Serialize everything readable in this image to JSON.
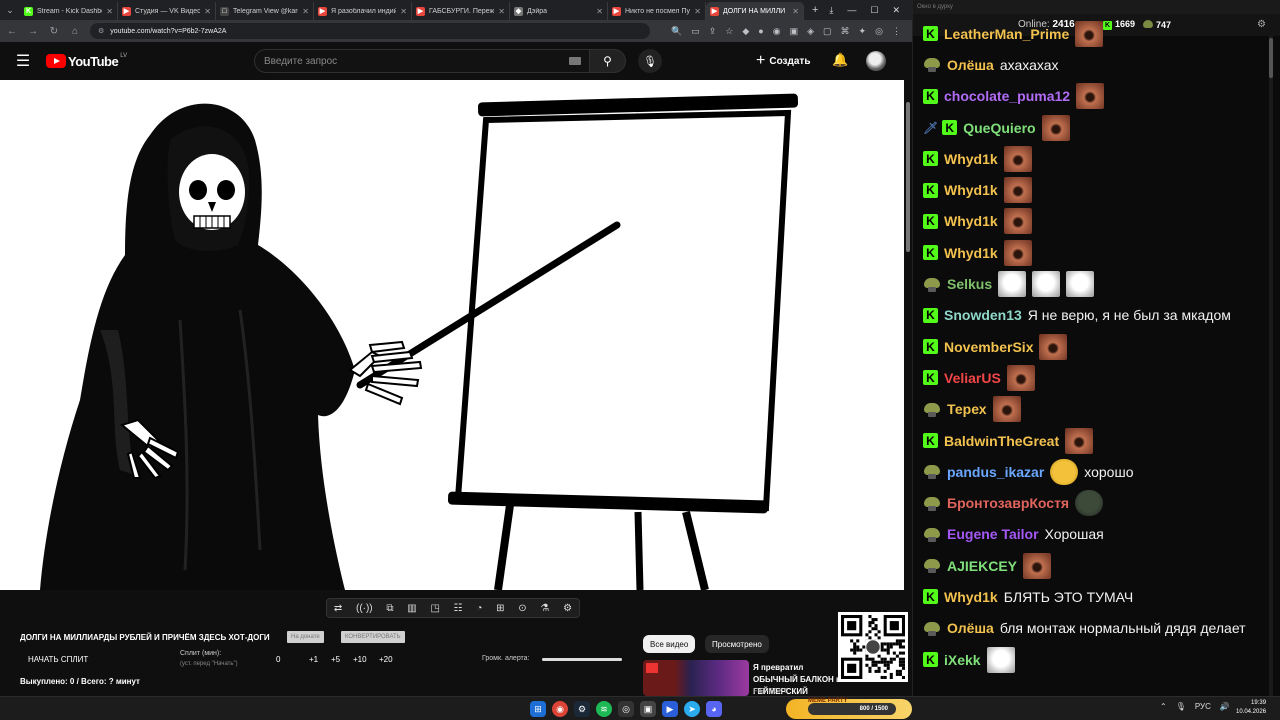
{
  "browser": {
    "tabs": [
      {
        "title": "Stream - Kick Dashboard",
        "color": "#53fc18",
        "letter": "K"
      },
      {
        "title": "Студия — VK Видео Live",
        "color": "#e8453c",
        "letter": "▶"
      },
      {
        "title": "Telegram View @kargo",
        "color": "#444",
        "letter": "□"
      },
      {
        "title": "Я разоблачил индийск",
        "color": "#e8453c",
        "letter": "▶"
      },
      {
        "title": "ГАБСБУРГИ. Пережит",
        "color": "#e8453c",
        "letter": "▶"
      },
      {
        "title": "Дэйра",
        "color": "#777",
        "letter": "◆"
      },
      {
        "title": "Никто не посмел Пути",
        "color": "#e8453c",
        "letter": "▶"
      },
      {
        "title": "ДОЛГИ НА МИЛЛИ",
        "color": "#e8453c",
        "letter": "▶"
      }
    ],
    "url": "youtube.com/watch?v=P6b2-7zwA2A"
  },
  "youtube": {
    "logo_text": "YouTube",
    "country": "LV",
    "search_placeholder": "Введите запрос",
    "create_label": "Создать"
  },
  "panel": {
    "title": "ДОЛГИ НА МИЛЛИАРДЫ РУБЛЕЙ И ПРИЧЁМ ЗДЕСЬ ХОТ-ДОГИ",
    "badge1": "На донате",
    "badge2": "КОНВЕРТИРОВАТЬ",
    "start_split": "НАЧАТЬ СПЛИТ",
    "split_label": "Сплит (мин):",
    "split_sub": "(уст. перед \"Начать\")",
    "nums": [
      "0",
      "+1",
      "+5",
      "+10",
      "+20"
    ],
    "volume_label": "Громк. алерта:",
    "volume_level": 1.0,
    "bought": "Выкуплено: 0 / Всего: ? минут",
    "chip_all": "Все видео",
    "chip_watched": "Просмотрено",
    "rec_title": "Я превратил ОБЫЧНЫЙ БАЛКОН в ГЕЙМЕРСКИЙ",
    "rec_channel": "FISPECKT"
  },
  "chat": {
    "window_title": "Окно в дурку",
    "online_label": "Online:",
    "online_count": "2416",
    "kick_count": "1669",
    "frog_count": "747",
    "colors": {
      "kick": "#53fc18",
      "frog": "#8e9a4a"
    },
    "messages": [
      {
        "badge": "kick",
        "user": "LeatherMan_Prime",
        "color": "#f2c14e",
        "emotes": [
          "face"
        ],
        "text": ""
      },
      {
        "badge": "frog",
        "user": "Олёша",
        "color": "#f2c14e",
        "emotes": [],
        "text": "ахахахах"
      },
      {
        "badge": "kick",
        "user": "chocolate_puma12",
        "color": "#b16cf5",
        "emotes": [
          "face"
        ],
        "text": ""
      },
      {
        "badge": "sword-kick",
        "user": "QueQuiero",
        "color": "#7fe07a",
        "emotes": [
          "face"
        ],
        "text": ""
      },
      {
        "badge": "kick",
        "user": "Whyd1k",
        "color": "#f2c14e",
        "emotes": [
          "face"
        ],
        "text": ""
      },
      {
        "badge": "kick",
        "user": "Whyd1k",
        "color": "#f2c14e",
        "emotes": [
          "face"
        ],
        "text": ""
      },
      {
        "badge": "kick",
        "user": "Whyd1k",
        "color": "#f2c14e",
        "emotes": [
          "face"
        ],
        "text": ""
      },
      {
        "badge": "kick",
        "user": "Whyd1k",
        "color": "#f2c14e",
        "emotes": [
          "face"
        ],
        "text": ""
      },
      {
        "badge": "frog",
        "user": "Selkus",
        "color": "#7fc06a",
        "emotes": [
          "cat",
          "cat",
          "cat"
        ],
        "text": ""
      },
      {
        "badge": "kick",
        "user": "Snowden13",
        "color": "#8fd8c8",
        "emotes": [],
        "text": "Я не верю, я не был за мкадом"
      },
      {
        "badge": "kick",
        "user": "NovemberSix",
        "color": "#f2c14e",
        "emotes": [
          "face"
        ],
        "text": ""
      },
      {
        "badge": "kick",
        "user": "VeliarUS",
        "color": "#f24646",
        "emotes": [
          "face"
        ],
        "text": ""
      },
      {
        "badge": "frog",
        "user": "Терех",
        "color": "#f2c14e",
        "emotes": [
          "face"
        ],
        "text": ""
      },
      {
        "badge": "kick",
        "user": "BaldwinTheGreat",
        "color": "#f2c14e",
        "emotes": [
          "face"
        ],
        "text": ""
      },
      {
        "badge": "frog",
        "user": "pandus_ikazar",
        "color": "#6aa7ff",
        "emotes": [
          "lol"
        ],
        "text": "хорошо"
      },
      {
        "badge": "frog",
        "user": "БронтозаврКостя",
        "color": "#e0645c",
        "emotes": [
          "dino"
        ],
        "text": ""
      },
      {
        "badge": "frog",
        "user": "Eugene Tailor",
        "color": "#a458f5",
        "emotes": [],
        "text": "Хорошая"
      },
      {
        "badge": "frog",
        "user": "AJIEKCEY",
        "color": "#7fe07a",
        "emotes": [
          "face"
        ],
        "text": ""
      },
      {
        "badge": "kick",
        "user": "Whyd1k",
        "color": "#f2c14e",
        "emotes": [],
        "text": "БЛЯТЬ ЭТО ТУМАЧ"
      },
      {
        "badge": "frog",
        "user": "Олёша",
        "color": "#f2c14e",
        "emotes": [],
        "text": "бля монтаж нормальный дядя делает"
      },
      {
        "badge": "kick",
        "user": "iXekk",
        "color": "#7fe07a",
        "emotes": [
          "cat"
        ],
        "text": ""
      }
    ]
  },
  "taskbar": {
    "meme_label": "MEME PARTY",
    "meme_progress": "800 / 1500",
    "lang": "РУС",
    "time": "19:39",
    "date": "10.04.2026"
  }
}
